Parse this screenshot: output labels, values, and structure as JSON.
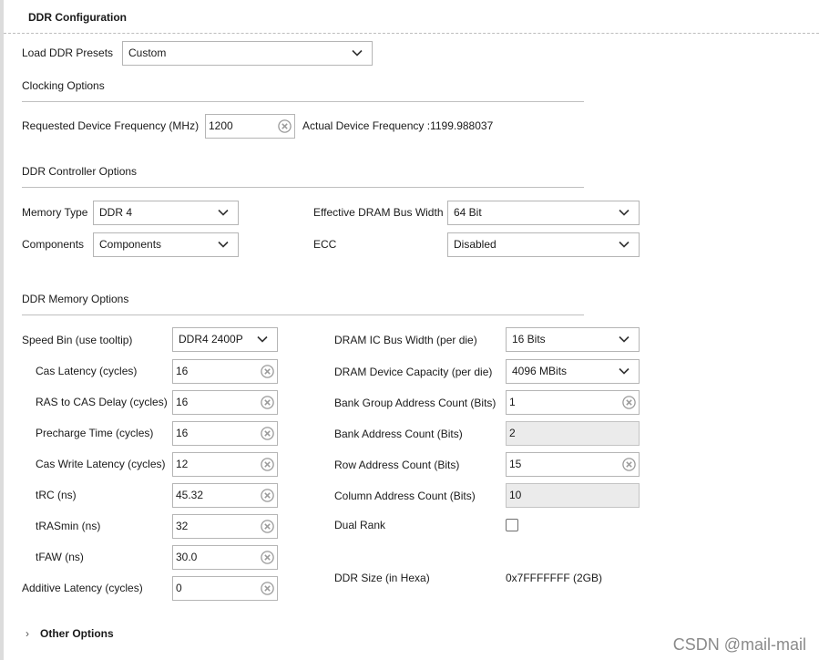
{
  "page_title": "DDR Configuration",
  "presets": {
    "label": "Load DDR Presets",
    "value": "Custom"
  },
  "clocking": {
    "title": "Clocking Options",
    "requested_label": "Requested Device Frequency (MHz)",
    "requested_value": "1200",
    "actual_label": "Actual Device Frequency :1199.988037"
  },
  "controller": {
    "title": "DDR Controller Options",
    "memory_type_label": "Memory Type",
    "memory_type_value": "DDR 4",
    "components_label": "Components",
    "components_value": "Components",
    "bus_width_label": "Effective DRAM Bus Width",
    "bus_width_value": "64 Bit",
    "ecc_label": "ECC",
    "ecc_value": "Disabled"
  },
  "memory": {
    "title": "DDR Memory Options",
    "speed_bin_label": "Speed Bin (use tooltip)",
    "speed_bin_value": "DDR4 2400P",
    "cas_latency_label": "Cas Latency (cycles)",
    "cas_latency_value": "16",
    "ras_cas_label": "RAS to CAS Delay (cycles)",
    "ras_cas_value": "16",
    "precharge_label": "Precharge Time (cycles)",
    "precharge_value": "16",
    "cas_write_label": "Cas Write Latency (cycles)",
    "cas_write_value": "12",
    "trc_label": "tRC (ns)",
    "trc_value": "45.32",
    "trasmin_label": "tRASmin (ns)",
    "trasmin_value": "32",
    "tfaw_label": "tFAW (ns)",
    "tfaw_value": "30.0",
    "additive_label": "Additive Latency (cycles)",
    "additive_value": "0",
    "ic_bus_label": "DRAM IC Bus Width (per die)",
    "ic_bus_value": "16 Bits",
    "capacity_label": "DRAM Device Capacity (per die)",
    "capacity_value": "4096 MBits",
    "bank_group_label": "Bank Group Address Count (Bits)",
    "bank_group_value": "1",
    "bank_addr_label": "Bank Address Count (Bits)",
    "bank_addr_value": "2",
    "row_addr_label": "Row Address Count (Bits)",
    "row_addr_value": "15",
    "col_addr_label": "Column Address Count (Bits)",
    "col_addr_value": "10",
    "dual_rank_label": "Dual Rank",
    "dual_rank_checked": false,
    "ddr_size_label": "DDR Size (in Hexa)",
    "ddr_size_value": "0x7FFFFFFF (2GB)"
  },
  "other_options": "Other Options",
  "watermark": "CSDN @mail-mail",
  "icons": {
    "dropdown": "chevron-down-icon",
    "clear": "clear-circle-icon",
    "expand": "chevron-right-icon"
  },
  "colors": {
    "border": "#b5b5b5",
    "readonly_bg": "#ebebeb",
    "clear_icon": "#9a9a9a"
  }
}
